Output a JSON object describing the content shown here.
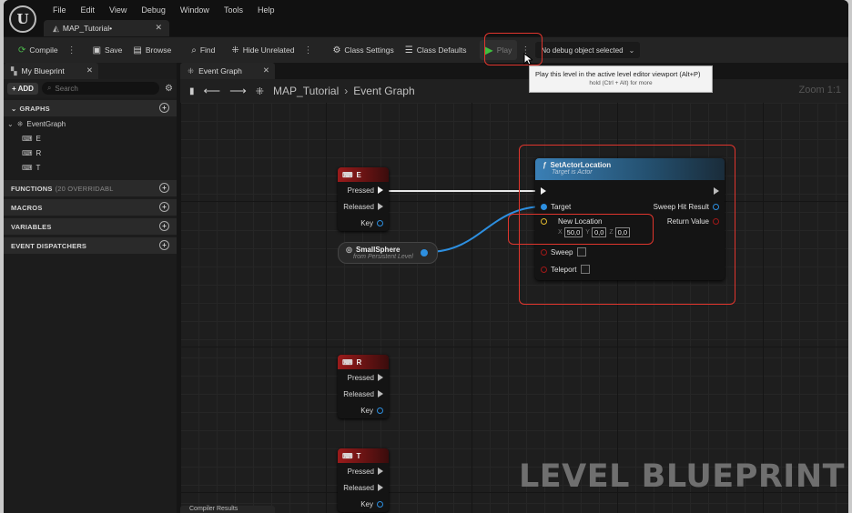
{
  "app": {
    "logo_glyph": "U",
    "menu": [
      "File",
      "Edit",
      "View",
      "Debug",
      "Window",
      "Tools",
      "Help"
    ],
    "document_tab": "MAP_Tutorial•"
  },
  "toolbar": {
    "compile": "Compile",
    "save": "Save",
    "browse": "Browse",
    "find": "Find",
    "hide_unrelated": "Hide Unrelated",
    "class_settings": "Class Settings",
    "class_defaults": "Class Defaults",
    "play": "Play",
    "debug_object": "No debug object selected"
  },
  "tooltip": {
    "line1": "Play this level in the active level editor viewport (Alt+P)",
    "line2": "hold (Ctrl + Alt) for more"
  },
  "my_blueprint": {
    "tab": "My Blueprint",
    "add": "+ ADD",
    "search_placeholder": "Search",
    "sections": {
      "graphs": "GRAPHS",
      "functions": "FUNCTIONS",
      "functions_sub": "(20 OVERRIDABL",
      "macros": "MACROS",
      "variables": "VARIABLES",
      "event_dispatchers": "EVENT DISPATCHERS"
    },
    "event_graph": "EventGraph",
    "events": [
      "E",
      "R",
      "T"
    ]
  },
  "graph": {
    "tab": "Event Graph",
    "breadcrumb_root": "MAP_Tutorial",
    "breadcrumb_current": "Event Graph",
    "zoom": "Zoom 1:1",
    "watermark": "LEVEL BLUEPRINT",
    "compiler_tab": "Compiler Results"
  },
  "nodes": {
    "key_e": {
      "title": "E",
      "pressed": "Pressed",
      "released": "Released",
      "key": "Key"
    },
    "key_r": {
      "title": "R",
      "pressed": "Pressed",
      "released": "Released",
      "key": "Key"
    },
    "key_t": {
      "title": "T",
      "pressed": "Pressed",
      "released": "Released",
      "key": "Key"
    },
    "small_sphere": {
      "name": "SmallSphere",
      "from": "from Persistent Level"
    },
    "set_actor_location": {
      "title": "SetActorLocation",
      "subtitle": "Target is Actor",
      "target": "Target",
      "new_location": "New Location",
      "x_label": "X",
      "x_value": "50,0",
      "y_label": "Y",
      "y_value": "0,0",
      "z_label": "Z",
      "z_value": "0,0",
      "sweep": "Sweep",
      "teleport": "Teleport",
      "sweep_hit_result": "Sweep Hit Result",
      "return_value": "Return Value"
    }
  },
  "colors": {
    "highlight": "#e0352d",
    "event_header": "#9a1b1b",
    "function_header": "#3a7fb5",
    "object_pin": "#2d8fe0",
    "vector_pin": "#e0b830",
    "play_icon": "#3fbf3f"
  }
}
